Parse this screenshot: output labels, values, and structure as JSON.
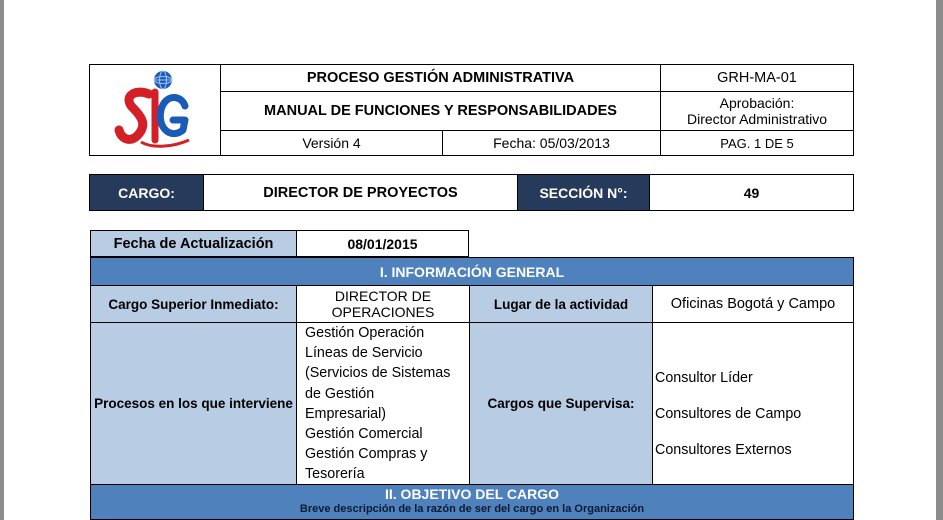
{
  "header": {
    "process": "PROCESO GESTIÓN ADMINISTRATIVA",
    "manual": "MANUAL DE FUNCIONES Y RESPONSABILIDADES",
    "code": "GRH-MA-01",
    "approval_label": "Aprobación:",
    "approval_value": "Director Administrativo",
    "version": "Versión  4",
    "date": "Fecha:   05/03/2013",
    "page": "PAG. 1 DE 5"
  },
  "cargo": {
    "label": "CARGO:",
    "value": "DIRECTOR DE PROYECTOS",
    "section_label": "SECCIÓN N°:",
    "section_value": "49"
  },
  "update": {
    "label": "Fecha de Actualización",
    "value": "08/01/2015"
  },
  "general": {
    "title": "I. INFORMACIÓN GENERAL",
    "superior_label": "Cargo Superior Inmediato:",
    "superior_value_1": "DIRECTOR DE",
    "superior_value_2": "OPERACIONES",
    "place_label": "Lugar de la actividad",
    "place_value": "Oficinas Bogotá y Campo",
    "processes_label": "Procesos en los que interviene",
    "processes": [
      "Gestión Operación",
      "Líneas de Servicio",
      "(Servicios de Sistemas",
      "de Gestión",
      "Empresarial)",
      "Gestión Comercial",
      "Gestión Compras y",
      "Tesorería"
    ],
    "supervises_label": "Cargos que  Supervisa:",
    "supervises": [
      "Consultor Líder",
      "Consultores de Campo",
      "Consultores Externos"
    ]
  },
  "objective": {
    "title": "II. OBJETIVO DEL CARGO",
    "subtitle": "Breve descripción de la razón de ser del cargo en la Organización"
  },
  "colors": {
    "navy": "#263a5b",
    "section_blue": "#4f81bd",
    "label_blue": "#b8cce4",
    "logo_red": "#d41f26",
    "logo_blue": "#1b5bb8"
  }
}
